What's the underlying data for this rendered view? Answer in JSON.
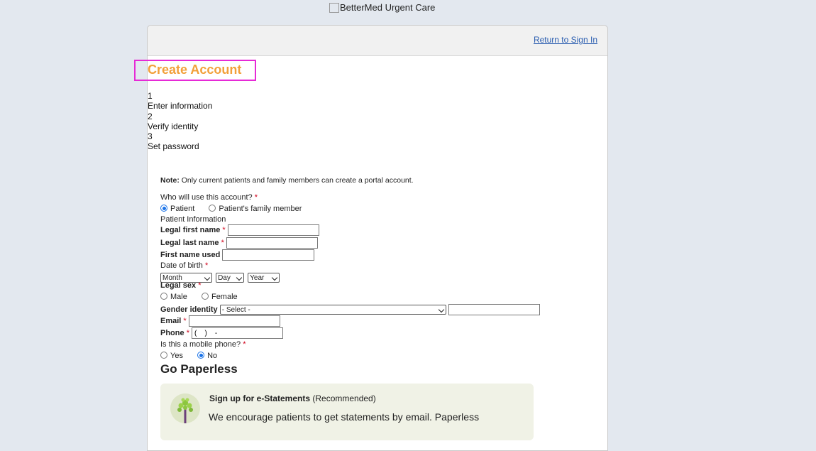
{
  "header": {
    "logo_alt": "BetterMed Urgent Care",
    "return_link": "Return to Sign In"
  },
  "title": "Create Account",
  "steps": [
    {
      "number": "1",
      "label": "Enter information"
    },
    {
      "number": "2",
      "label": "Verify identity"
    },
    {
      "number": "3",
      "label": "Set password"
    }
  ],
  "form": {
    "note_bold": "Note:",
    "note_text": " Only current patients and family members can create a portal account.",
    "who_label": "Who will use this account?",
    "who_options": [
      "Patient",
      "Patient's family member"
    ],
    "who_selected": "Patient",
    "patient_info_label": "Patient Information",
    "first_name_label": "Legal first name",
    "first_name_value": "",
    "last_name_label": "Legal last name",
    "last_name_value": "",
    "first_name_used_label": "First name used",
    "first_name_used_value": "",
    "dob_label": "Date of birth",
    "dob_month": "Month",
    "dob_day": "Day",
    "dob_year": "Year",
    "sex_label": "Legal sex",
    "sex_options": [
      "Male",
      "Female"
    ],
    "sex_selected": "",
    "gender_label": "Gender identity",
    "gender_select": "- Select -",
    "gender_other_value": "",
    "email_label": "Email",
    "email_value": "",
    "phone_label": "Phone",
    "phone_value": "(    )    -",
    "mobile_label": "Is this a mobile phone?",
    "mobile_options": [
      "Yes",
      "No"
    ],
    "mobile_selected": "No",
    "required_mark": "*"
  },
  "paperless": {
    "heading": "Go Paperless",
    "estatement_title": "Sign up for e-Statements",
    "estatement_recommended": "(Recommended)",
    "estatement_body": "We encourage patients to get statements by email. Paperless"
  },
  "colors": {
    "title": "#f2a03a",
    "highlight": "#e62ad6",
    "link": "#2a5db0",
    "required": "#d0021b",
    "page_bg": "#e3e8ef",
    "radio_checked": "#1a73e8"
  }
}
